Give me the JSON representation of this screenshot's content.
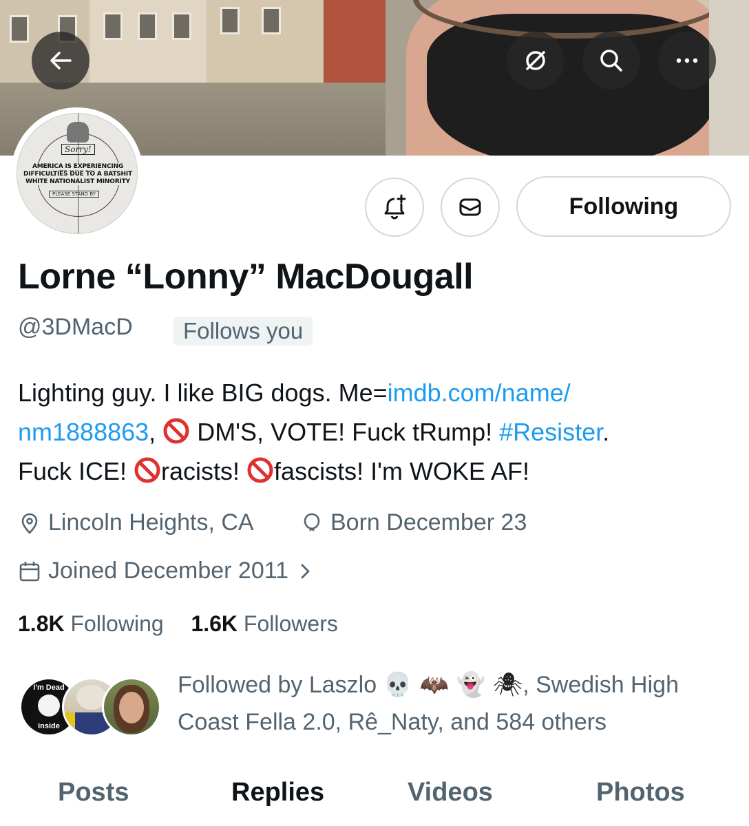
{
  "header": {
    "back_icon": "arrow-left-icon",
    "grok_icon": "grok-icon",
    "search_icon": "search-icon",
    "more_icon": "more-horizontal-icon"
  },
  "avatar": {
    "sorry": "Sorry!",
    "line1": "AMERICA IS EXPERIENCING TECHNICAL",
    "line2": "DIFFICULTIES DUE TO A BATSHIT",
    "line3": "WHITE NATIONALIST MINORITY",
    "stand_by": "PLEASE STAND BY"
  },
  "actions": {
    "notify_icon": "bell-plus-icon",
    "message_icon": "envelope-icon",
    "follow_label": "Following"
  },
  "profile": {
    "name": "Lorne “Lonny” MacDougall",
    "handle": "@3DMacD",
    "follows_you": "Follows you",
    "bio": {
      "l1_text": "Lighting guy. I like BIG dogs. Me=",
      "l1_link": "imdb.com/name/",
      "l2_link": "nm1888863",
      "l2_comma": ", ",
      "l2_text": " DM'S, VOTE! Fuck tRump! ",
      "l2_hashtag": "#Resister",
      "l2_end": ".",
      "l3_a": "Fuck ICE! ",
      "l3_b": "racists! ",
      "l3_c": "fascists! I'm WOKE AF!"
    },
    "location": "Lincoln Heights, CA",
    "birthday": "Born December 23",
    "joined": "Joined December 2011"
  },
  "stats": {
    "following_count": "1.8K",
    "following_label": " Following",
    "followers_count": "1.6K",
    "followers_label": " Followers"
  },
  "followed_by": {
    "line1_a": "Followed by Laszlo ",
    "emojis": "💀 🦇 👻 🕷",
    "line1_b": ", Swedish High",
    "line2": "Coast Fella 2.0, Rê_Naty, and 584 others",
    "avatar1_text_top": "I'm Dead",
    "avatar1_text_bottom": "inside"
  },
  "tabs": [
    "Posts",
    "Replies",
    "Videos",
    "Photos"
  ],
  "colors": {
    "link": "#1d9bf0",
    "muted": "#536471",
    "text": "#0f1419"
  }
}
